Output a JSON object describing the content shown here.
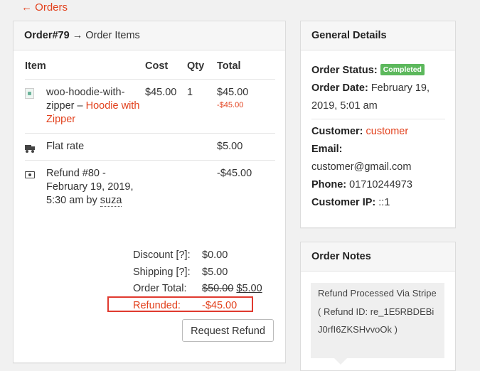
{
  "back_link": "← Orders",
  "items_panel": {
    "order_no": "Order#79",
    "arrow": "→",
    "title": "Order Items",
    "headers": {
      "item": "Item",
      "cost": "Cost",
      "qty": "Qty",
      "total": "Total"
    },
    "product": {
      "sku": "woo-hoodie-with-zipper –",
      "name": "Hoodie with Zipper",
      "cost": "$45.00",
      "qty": "1",
      "total": "$45.00",
      "refunded": "-$45.00"
    },
    "shipping": {
      "name": "Flat rate",
      "total": "$5.00"
    },
    "refund": {
      "text": "Refund #80 - February 19, 2019, 5:30 am by",
      "user": "suza",
      "total": "-$45.00"
    },
    "totals": {
      "discount_label": "Discount [?]:",
      "discount_value": "$0.00",
      "shipping_label": "Shipping [?]:",
      "shipping_value": "$5.00",
      "order_total_label": "Order Total:",
      "order_total_old": "$50.00",
      "order_total_new": "$5.00",
      "refunded_label": "Refunded:",
      "refunded_value": "-$45.00"
    },
    "refund_button": "Request Refund"
  },
  "details": {
    "title": "General Details",
    "status_label": "Order Status:",
    "status_value": "Completed",
    "date_label": "Order Date:",
    "date_value": "February 19, 2019, 5:01 am",
    "customer_label": "Customer:",
    "customer_value": "customer",
    "email_label": "Email:",
    "email_value": "customer@gmail.com",
    "phone_label": "Phone:",
    "phone_value": "01710244973",
    "ip_label": "Customer IP:",
    "ip_value": "::1"
  },
  "notes": {
    "title": "Order Notes",
    "note_text": "Refund Processed Via Stripe ( Refund ID: re_1E5RBDEBiJ0rfI6ZKSHvvoOk )"
  },
  "colors": {
    "accent": "#e2401c",
    "status_badge": "#5cb85c",
    "highlight_box": "#e03a2f"
  },
  "icons": {
    "product": "product-thumbnail-icon",
    "shipping": "truck-icon",
    "refund": "money-icon"
  }
}
